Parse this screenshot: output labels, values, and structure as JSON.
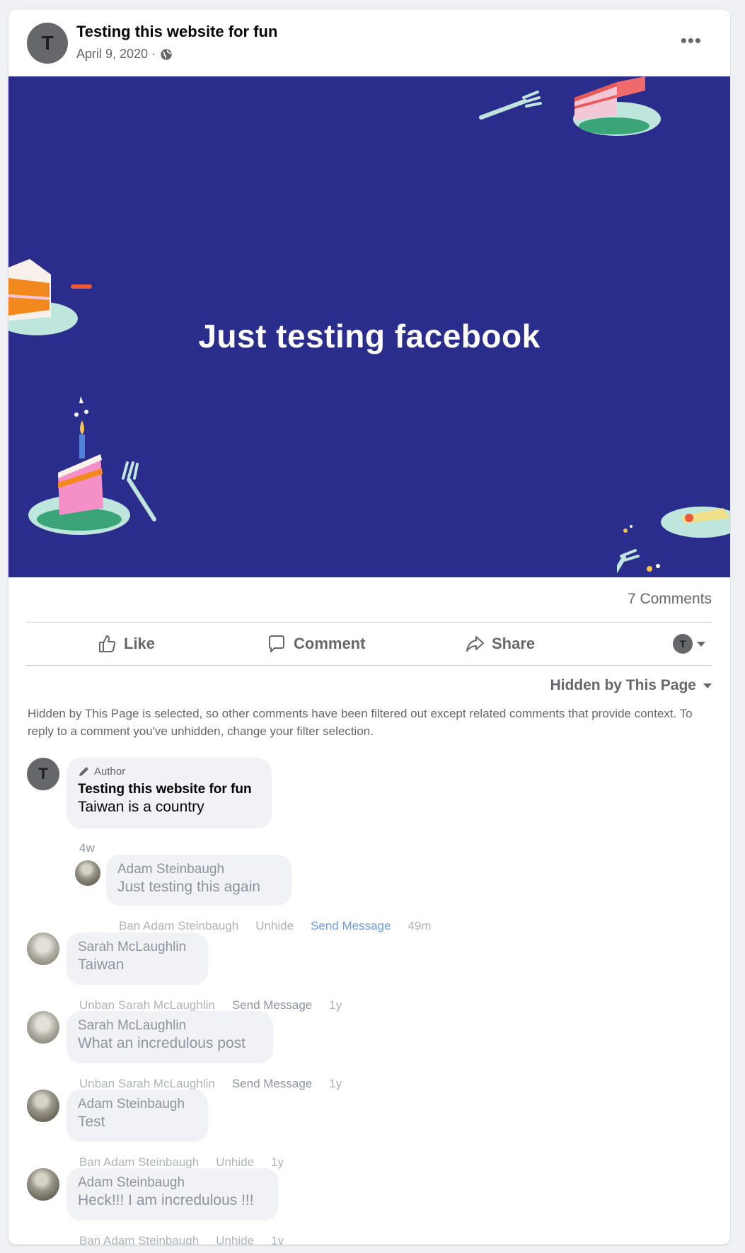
{
  "post": {
    "title": "Testing this website for fun",
    "date": "April 9, 2020 ·",
    "avatar_letter": "T",
    "more_icon": "more-horizontal-icon",
    "banner_text": "Just testing facebook",
    "banner_color": "#2b2d8c"
  },
  "stats": {
    "comments": "7 Comments"
  },
  "actions": {
    "like": "Like",
    "comment": "Comment",
    "share": "Share",
    "audience_letter": "T"
  },
  "filter": {
    "label": "Hidden by This Page",
    "note": "Hidden by This Page is selected, so other comments have been filtered out except related comments that provide context. To reply to a comment you've unhidden, change your filter selection."
  },
  "comments": [
    {
      "badge": "Author",
      "name": "Testing this website for fun",
      "text": "Taiwan is a country",
      "time": "4w",
      "avatar_letter": "T"
    },
    {
      "name": "Adam Steinbaugh",
      "text": "Just testing this again",
      "action1": "Ban Adam Steinbaugh",
      "action2": "Unhide",
      "action3": "Send Message",
      "time": "49m"
    },
    {
      "name": "Sarah McLaughlin",
      "text": "Taiwan",
      "action1": "Unban Sarah McLaughlin",
      "action2": "Send Message",
      "time": "1y"
    },
    {
      "name": "Sarah McLaughlin",
      "text": "What an incredulous post",
      "action1": "Unban Sarah McLaughlin",
      "action2": "Send Message",
      "time": "1y"
    },
    {
      "name": "Adam Steinbaugh",
      "text": "Test",
      "action1": "Ban Adam Steinbaugh",
      "action2": "Unhide",
      "time": "1y"
    },
    {
      "name": "Adam Steinbaugh",
      "text": "Heck!!! I am incredulous !!!",
      "action1": "Ban Adam Steinbaugh",
      "action2": "Unhide",
      "time": "1y"
    }
  ]
}
